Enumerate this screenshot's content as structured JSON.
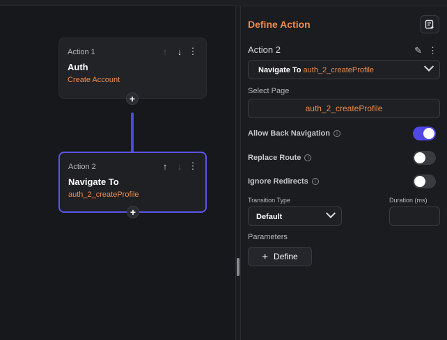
{
  "canvas": {
    "cards": [
      {
        "label": "Action 1",
        "title": "Auth",
        "subtitle": "Create Account"
      },
      {
        "label": "Action 2",
        "title": "Navigate To",
        "subtitle": "auth_2_createProfile"
      }
    ],
    "add_icon": "plus-icon"
  },
  "panel": {
    "title": "Define Action",
    "action_name": "Action 2",
    "action_select": {
      "type": "Navigate To",
      "target": "auth_2_createProfile"
    },
    "select_page_label": "Select Page",
    "select_page_value": "auth_2_createProfile",
    "options": [
      {
        "label": "Allow Back Navigation",
        "on": true
      },
      {
        "label": "Replace Route",
        "on": false
      },
      {
        "label": "Ignore Redirects",
        "on": false
      }
    ],
    "transition_type_label": "Transition Type",
    "transition_type_value": "Default",
    "duration_label": "Duration (ms)",
    "duration_value": "",
    "parameters_label": "Parameters",
    "define_button": "Define"
  },
  "colors": {
    "accent": "#4f47e6",
    "orange": "#ee8b4b",
    "background": "#17181b"
  }
}
